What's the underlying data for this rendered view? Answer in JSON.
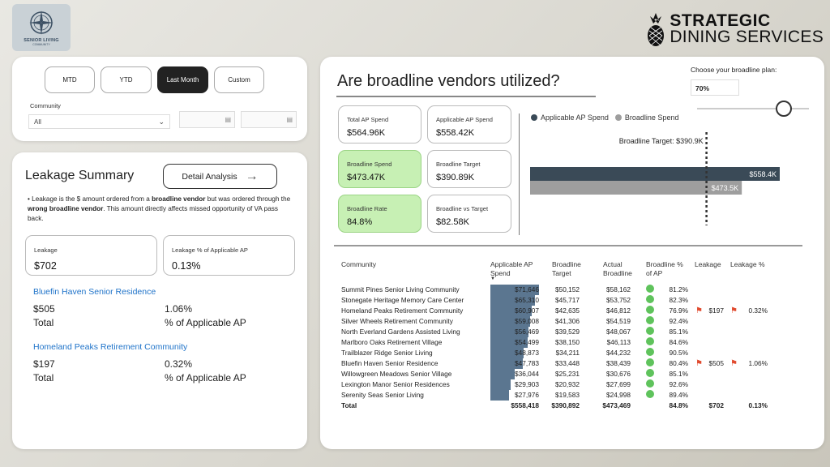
{
  "logo": {
    "line1": "SENIOR LIVING",
    "line2": "COMMUNITY"
  },
  "brand": {
    "line1": "STRATEGIC",
    "line2": "DINING SERVICES"
  },
  "filters": {
    "periods": [
      "MTD",
      "YTD",
      "Last Month",
      "Custom"
    ],
    "active_period": "Last Month",
    "community_label": "Community",
    "community_value": "All"
  },
  "leakage": {
    "title": "Leakage Summary",
    "detail_button": "Detail Analysis",
    "note_parts": [
      "• Leakage is the $ amount ordered from a ",
      "broadline vendor",
      " but was ordered through the ",
      "wrong broadline vendor",
      ".  This amount directly affects missed opportunity of VA pass back."
    ],
    "kpi_leakage_label": "Leakage",
    "kpi_leakage_value": "$702",
    "kpi_pct_label": "Leakage % of Applicable AP",
    "kpi_pct_value": "0.13%",
    "communities": [
      {
        "name": "Bluefin Haven Senior Residence",
        "amount": "$505",
        "pct": "1.06%",
        "amount_label": "Total",
        "pct_label": "% of Applicable AP"
      },
      {
        "name": "Homeland Peaks Retirement Community",
        "amount": "$197",
        "pct": "0.32%",
        "amount_label": "Total",
        "pct_label": "% of Applicable AP"
      }
    ]
  },
  "main": {
    "title": "Are broadline vendors utilized?",
    "plan_label": "Choose your broadline plan:",
    "plan_value": "70%",
    "plan_slider_fraction": 0.7,
    "kpis": [
      {
        "label": "Total AP Spend",
        "value": "$564.96K",
        "green": false
      },
      {
        "label": "Applicable AP Spend",
        "value": "$558.42K",
        "green": false
      },
      {
        "label": "Broadline Spend",
        "value": "$473.47K",
        "green": true
      },
      {
        "label": "Broadline Target",
        "value": "$390.89K",
        "green": false
      },
      {
        "label": "Broadline Rate",
        "value": "84.8%",
        "green": true
      },
      {
        "label": "Broadline vs Target",
        "value": "$82.58K",
        "green": false
      }
    ]
  },
  "chart_data": {
    "type": "bar",
    "orientation": "horizontal",
    "series": [
      {
        "name": "Applicable AP Spend",
        "value": 558.4,
        "label": "$558.4K",
        "color": "#3a4a57"
      },
      {
        "name": "Broadline Spend",
        "value": 473.5,
        "label": "$473.5K",
        "color": "#9e9e9e"
      }
    ],
    "target": {
      "label": "Broadline Target: $390.9K",
      "value": 390.9
    },
    "xlim": [
      0,
      558.4
    ]
  },
  "table": {
    "headers": [
      "Community",
      "Applicable AP Spend",
      "Broadline Target",
      "Actual Broadline",
      "Broadline % of AP",
      "Leakage",
      "Leakage %"
    ],
    "bar_max": 71646,
    "rows": [
      {
        "name": "Summit Pines Senior Living Community",
        "ap_val": 71646,
        "ap": "$71,646",
        "target": "$50,152",
        "actual": "$58,162",
        "pct": "81.2%",
        "leak": "",
        "leak_pct": ""
      },
      {
        "name": "Stonegate Heritage Memory Care Center",
        "ap_val": 65310,
        "ap": "$65,310",
        "target": "$45,717",
        "actual": "$53,752",
        "pct": "82.3%",
        "leak": "",
        "leak_pct": ""
      },
      {
        "name": "Homeland Peaks Retirement Community",
        "ap_val": 60907,
        "ap": "$60,907",
        "target": "$42,635",
        "actual": "$46,812",
        "pct": "76.9%",
        "leak": "$197",
        "leak_pct": "0.32%"
      },
      {
        "name": "Silver Wheels Retirement Community",
        "ap_val": 59008,
        "ap": "$59,008",
        "target": "$41,306",
        "actual": "$54,519",
        "pct": "92.4%",
        "leak": "",
        "leak_pct": ""
      },
      {
        "name": "North Everland Gardens Assisted Living",
        "ap_val": 56469,
        "ap": "$56,469",
        "target": "$39,529",
        "actual": "$48,067",
        "pct": "85.1%",
        "leak": "",
        "leak_pct": ""
      },
      {
        "name": "Marlboro Oaks Retirement Village",
        "ap_val": 54499,
        "ap": "$54,499",
        "target": "$38,150",
        "actual": "$46,113",
        "pct": "84.6%",
        "leak": "",
        "leak_pct": ""
      },
      {
        "name": "Trailblazer Ridge Senior Living",
        "ap_val": 48873,
        "ap": "$48,873",
        "target": "$34,211",
        "actual": "$44,232",
        "pct": "90.5%",
        "leak": "",
        "leak_pct": ""
      },
      {
        "name": "Bluefin Haven Senior Residence",
        "ap_val": 47783,
        "ap": "$47,783",
        "target": "$33,448",
        "actual": "$38,439",
        "pct": "80.4%",
        "leak": "$505",
        "leak_pct": "1.06%"
      },
      {
        "name": "Willowgreen Meadows Senior Village",
        "ap_val": 36044,
        "ap": "$36,044",
        "target": "$25,231",
        "actual": "$30,676",
        "pct": "85.1%",
        "leak": "",
        "leak_pct": ""
      },
      {
        "name": "Lexington Manor Senior Residences",
        "ap_val": 29903,
        "ap": "$29,903",
        "target": "$20,932",
        "actual": "$27,699",
        "pct": "92.6%",
        "leak": "",
        "leak_pct": ""
      },
      {
        "name": "Serenity Seas Senior Living",
        "ap_val": 27976,
        "ap": "$27,976",
        "target": "$19,583",
        "actual": "$24,998",
        "pct": "89.4%",
        "leak": "",
        "leak_pct": ""
      }
    ],
    "total": {
      "name": "Total",
      "ap": "$558,418",
      "target": "$390,892",
      "actual": "$473,469",
      "pct": "84.8%",
      "leak": "$702",
      "leak_pct": "0.13%"
    }
  }
}
